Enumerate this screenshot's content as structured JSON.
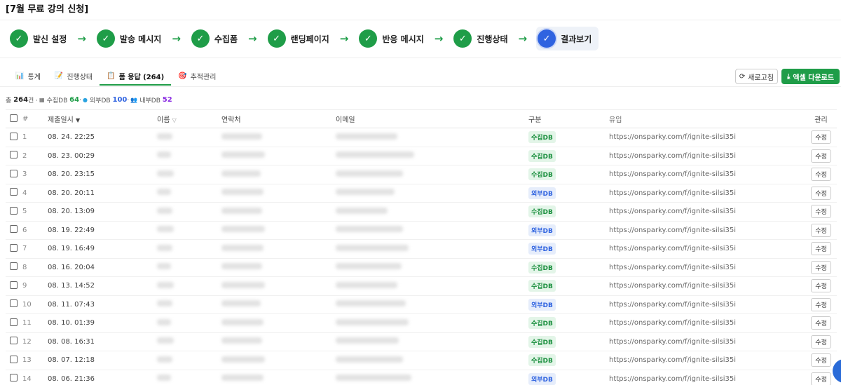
{
  "page_title": "[7월 무료 강의 신청]",
  "steps": [
    {
      "label": "발신 설정",
      "icon": "check-icon",
      "state": "done"
    },
    {
      "label": "발송 메시지",
      "icon": "check-icon",
      "state": "done"
    },
    {
      "label": "수집폼",
      "icon": "check-icon",
      "state": "done"
    },
    {
      "label": "랜딩페이지",
      "icon": "check-icon",
      "state": "done"
    },
    {
      "label": "반응 메시지",
      "icon": "check-icon",
      "state": "done"
    },
    {
      "label": "진행상태",
      "icon": "check-icon",
      "state": "done"
    },
    {
      "label": "결과보기",
      "icon": "check-icon",
      "state": "current"
    }
  ],
  "tabs": [
    {
      "label": "통계",
      "icon": "bar-chart-icon",
      "active": false
    },
    {
      "label": "진행상태",
      "icon": "pencil-icon",
      "active": false
    },
    {
      "label": "폼 응답 (264)",
      "icon": "clipboard-icon",
      "active": true
    },
    {
      "label": "추적관리",
      "icon": "target-icon",
      "active": false
    }
  ],
  "toolbar": {
    "refresh_label": "새로고침",
    "excel_label": "엑셀 다운로드"
  },
  "summary": {
    "total_prefix": "총",
    "total_value": "264",
    "total_suffix": "건 ·",
    "collect_label": "수집DB",
    "collect_value": "64",
    "sep": "·",
    "external_label": "외부DB",
    "external_value": "100",
    "internal_label": "내부DB",
    "internal_value": "52"
  },
  "table": {
    "headers": {
      "num": "#",
      "date": "제출일시",
      "date_sort": "▼",
      "name": "이름",
      "name_sort": "▽",
      "phone": "연락처",
      "email": "이메일",
      "type": "구분",
      "source": "유입",
      "action": "관리"
    },
    "edit_label": "수정",
    "rows": [
      {
        "num": "1",
        "date": "08. 24. 22:25",
        "type": "수집DB",
        "kind": "collect",
        "source": "https://onsparky.com/f/ignite-silsi35i"
      },
      {
        "num": "2",
        "date": "08. 23. 00:29",
        "type": "수집DB",
        "kind": "collect",
        "source": "https://onsparky.com/f/ignite-silsi35i"
      },
      {
        "num": "3",
        "date": "08. 20. 23:15",
        "type": "수집DB",
        "kind": "collect",
        "source": "https://onsparky.com/f/ignite-silsi35i"
      },
      {
        "num": "4",
        "date": "08. 20. 20:11",
        "type": "외부DB",
        "kind": "external",
        "source": "https://onsparky.com/f/ignite-silsi35i"
      },
      {
        "num": "5",
        "date": "08. 20. 13:09",
        "type": "수집DB",
        "kind": "collect",
        "source": "https://onsparky.com/f/ignite-silsi35i"
      },
      {
        "num": "6",
        "date": "08. 19. 22:49",
        "type": "외부DB",
        "kind": "external",
        "source": "https://onsparky.com/f/ignite-silsi35i"
      },
      {
        "num": "7",
        "date": "08. 19. 16:49",
        "type": "외부DB",
        "kind": "external",
        "source": "https://onsparky.com/f/ignite-silsi35i"
      },
      {
        "num": "8",
        "date": "08. 16. 20:04",
        "type": "수집DB",
        "kind": "collect",
        "source": "https://onsparky.com/f/ignite-silsi35i"
      },
      {
        "num": "9",
        "date": "08. 13. 14:52",
        "type": "수집DB",
        "kind": "collect",
        "source": "https://onsparky.com/f/ignite-silsi35i"
      },
      {
        "num": "10",
        "date": "08. 11. 07:43",
        "type": "외부DB",
        "kind": "external",
        "source": "https://onsparky.com/f/ignite-silsi35i"
      },
      {
        "num": "11",
        "date": "08. 10. 01:39",
        "type": "수집DB",
        "kind": "collect",
        "source": "https://onsparky.com/f/ignite-silsi35i"
      },
      {
        "num": "12",
        "date": "08. 08. 16:31",
        "type": "수집DB",
        "kind": "collect",
        "source": "https://onsparky.com/f/ignite-silsi35i"
      },
      {
        "num": "13",
        "date": "08. 07. 12:18",
        "type": "수집DB",
        "kind": "collect",
        "source": "https://onsparky.com/f/ignite-silsi35i"
      },
      {
        "num": "14",
        "date": "08. 06. 21:36",
        "type": "외부DB",
        "kind": "external",
        "source": "https://onsparky.com/f/ignite-silsi35i"
      }
    ]
  },
  "colors": {
    "accent_green": "#1f9d48",
    "current_step_blue": "#2f63e0",
    "collect_badge": "#1a8f3e",
    "external_badge": "#2f63e0",
    "internal_value": "#8a2be2"
  }
}
